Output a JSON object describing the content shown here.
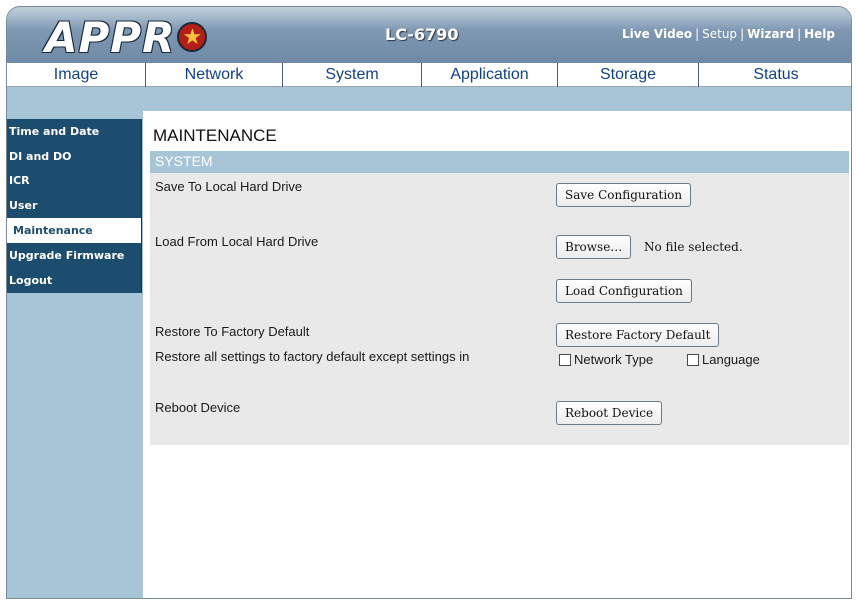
{
  "header": {
    "logo_text": "APPR",
    "model": "LC-6790",
    "links": {
      "live_video": "Live Video",
      "setup": "Setup",
      "wizard": "Wizard",
      "help": "Help",
      "separator": "|"
    }
  },
  "tabs": [
    "Image",
    "Network",
    "System",
    "Application",
    "Storage",
    "Status"
  ],
  "sidebar": {
    "items": [
      {
        "label": "Time and Date",
        "active": false
      },
      {
        "label": "DI and DO",
        "active": false
      },
      {
        "label": "ICR",
        "active": false
      },
      {
        "label": "User",
        "active": false
      },
      {
        "label": "Maintenance",
        "active": true
      },
      {
        "label": "Upgrade Firmware",
        "active": false
      },
      {
        "label": "Logout",
        "active": false
      }
    ]
  },
  "main": {
    "title": "MAINTENANCE",
    "section": "SYSTEM",
    "save_label": "Save To Local Hard Drive",
    "save_button": "Save Configuration",
    "load_label": "Load From Local Hard Drive",
    "browse_button": "Browse…",
    "file_status": "No file selected.",
    "load_button": "Load Configuration",
    "restore_label": "Restore To Factory Default",
    "restore_button": "Restore Factory Default",
    "restore_except_label": "Restore all settings to factory default except settings in",
    "checkbox_network": "Network Type",
    "checkbox_language": "Language",
    "reboot_label": "Reboot Device",
    "reboot_button": "Reboot Device"
  },
  "colors": {
    "accent": "#1d4d6e",
    "band": "#a8c5d8",
    "tab_text": "#10428a",
    "panel": "#e9e9e9"
  }
}
